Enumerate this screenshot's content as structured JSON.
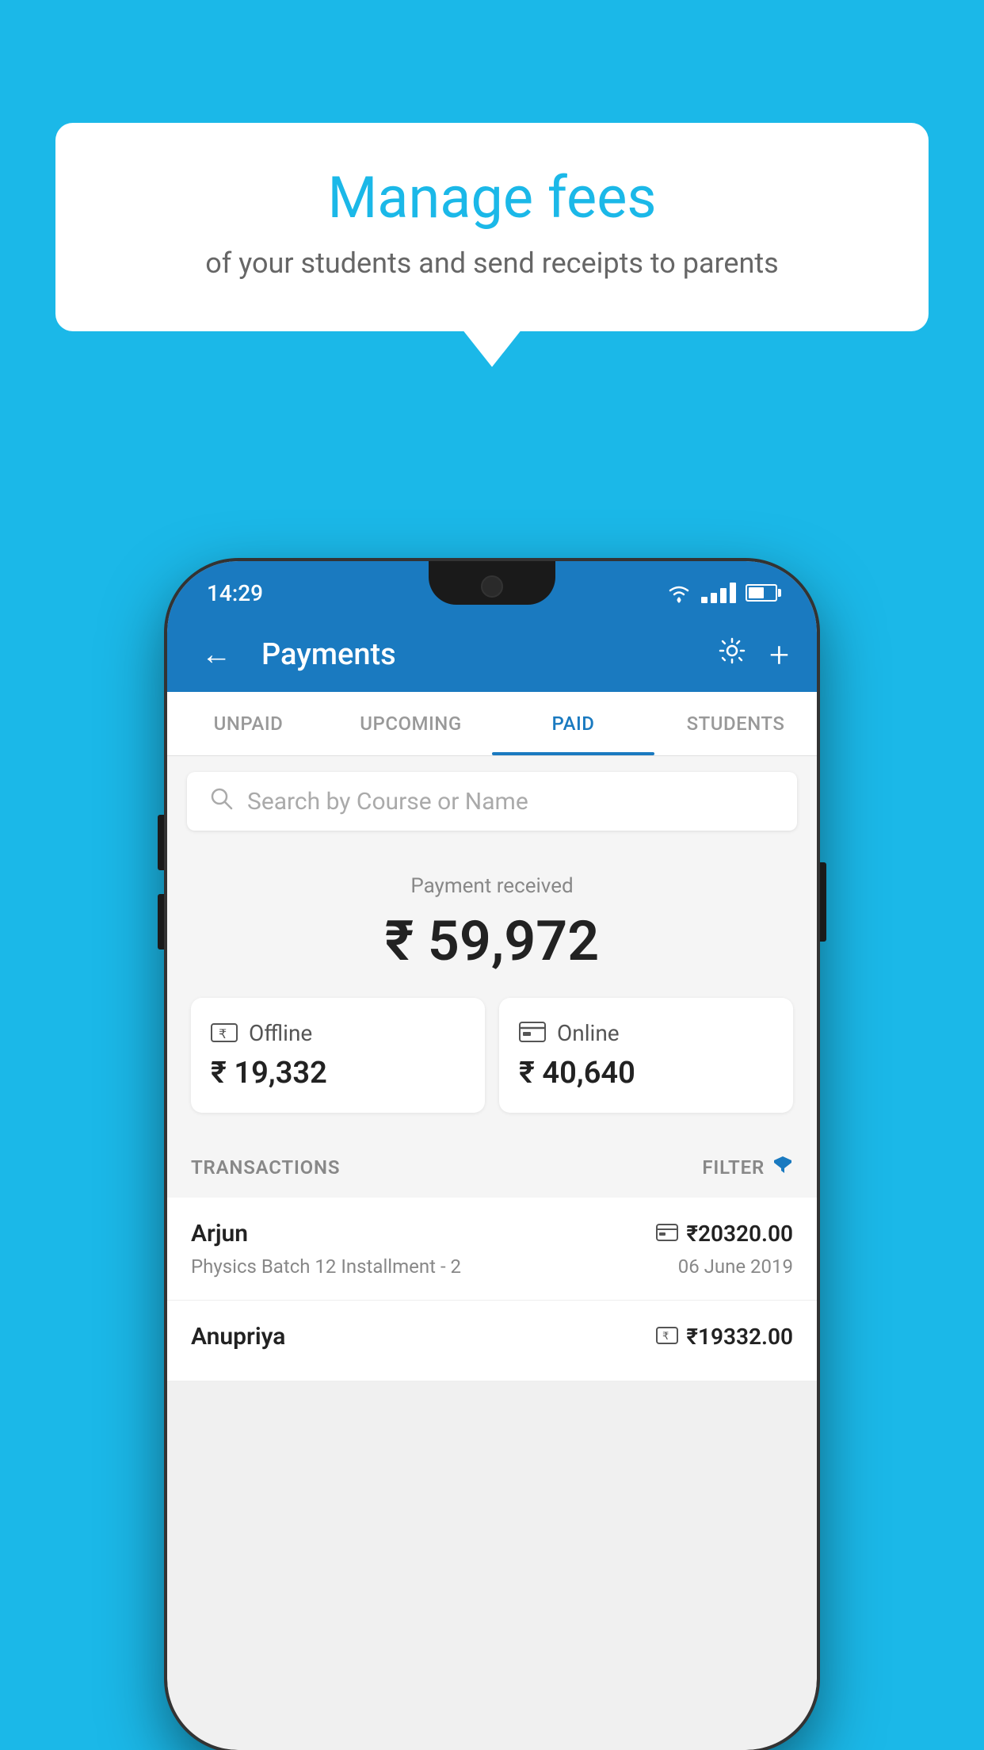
{
  "background_color": "#1BB8E8",
  "speech_bubble": {
    "title": "Manage fees",
    "subtitle": "of your students and send receipts to parents"
  },
  "phone": {
    "status_bar": {
      "time": "14:29"
    },
    "app_bar": {
      "title": "Payments",
      "back_label": "←",
      "plus_label": "+"
    },
    "tabs": [
      {
        "label": "UNPAID",
        "active": false
      },
      {
        "label": "UPCOMING",
        "active": false
      },
      {
        "label": "PAID",
        "active": true
      },
      {
        "label": "STUDENTS",
        "active": false
      }
    ],
    "search": {
      "placeholder": "Search by Course or Name"
    },
    "payment_summary": {
      "label": "Payment received",
      "amount": "₹ 59,972",
      "cards": [
        {
          "icon": "💳",
          "label": "Offline",
          "amount": "₹ 19,332"
        },
        {
          "icon": "💳",
          "label": "Online",
          "amount": "₹ 40,640"
        }
      ]
    },
    "transactions": {
      "header_label": "TRANSACTIONS",
      "filter_label": "FILTER",
      "rows": [
        {
          "name": "Arjun",
          "amount": "₹20320.00",
          "course": "Physics Batch 12 Installment - 2",
          "date": "06 June 2019",
          "payment_type": "online"
        },
        {
          "name": "Anupriya",
          "amount": "₹19332.00",
          "course": "",
          "date": "",
          "payment_type": "offline"
        }
      ]
    }
  }
}
